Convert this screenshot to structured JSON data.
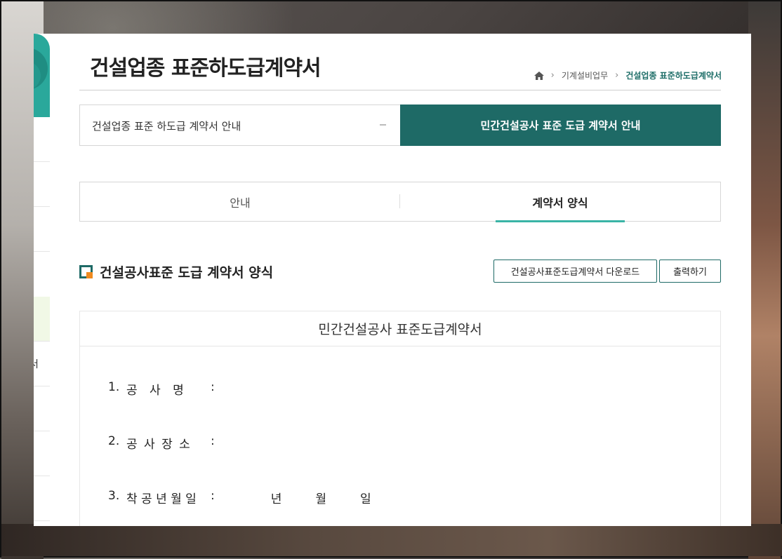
{
  "page": {
    "title": "건설업종 표준하도급계약서",
    "breadcrumb": {
      "parent": "기계설비업무",
      "current": "건설업종 표준하도급계약서"
    }
  },
  "sidebar": {
    "partial_text": "서"
  },
  "segments": {
    "left": "건설업종 표준 하도급 계약서 안내",
    "right": "민간건설공사 표준 도급 계약서 안내"
  },
  "tabs": [
    {
      "label": "안내"
    },
    {
      "label": "계약서 양식"
    }
  ],
  "section": {
    "title": "건설공사표준 도급 계약서 양식",
    "download_button": "건설공사표준도급계약서 다운로드",
    "print_button": "출력하기"
  },
  "document": {
    "heading": "민간건설공사 표준도급계약서",
    "rows": [
      {
        "num": "1.",
        "label": "공 사 명",
        "colon": ":"
      },
      {
        "num": "2.",
        "label": "공 사 장 소",
        "colon": ":"
      },
      {
        "num": "3.",
        "label": "착 공 년 월 일",
        "colon": ":",
        "date": [
          "년",
          "월",
          "일"
        ]
      }
    ]
  },
  "colors": {
    "accent": "#1e6a66",
    "tab_underline": "#3ab4a6",
    "icon_orange": "#ef8a1f"
  }
}
